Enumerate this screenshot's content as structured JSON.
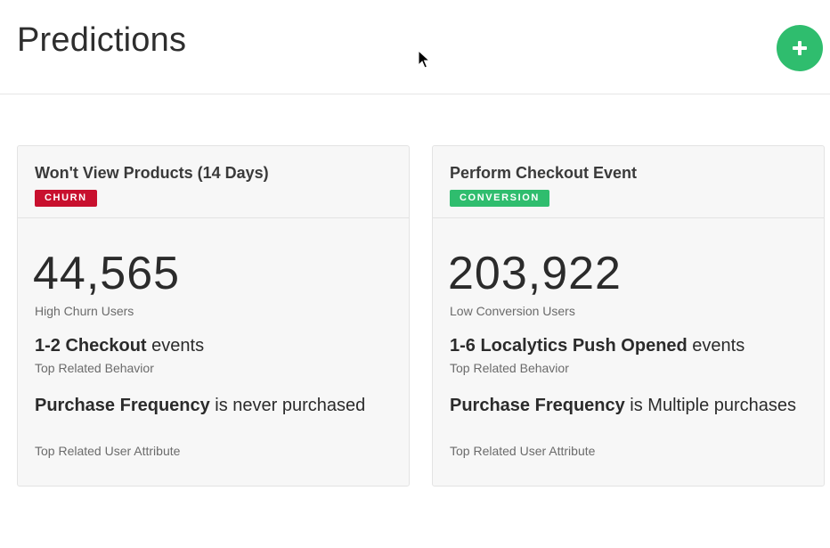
{
  "header": {
    "title": "Predictions",
    "add_button_icon": "plus-icon",
    "accent": "#2fbd6e"
  },
  "cards": [
    {
      "title": "Won't View Products (14 Days)",
      "badge": "CHURN",
      "badge_color": "#c8102e",
      "count": "44,565",
      "count_label": "High Churn Users",
      "behavior_strong": "1-2 Checkout",
      "behavior_rest": " events",
      "behavior_label": "Top Related Behavior",
      "attribute_strong": "Purchase Frequency",
      "attribute_rest": " is never purchased",
      "attribute_label": "Top Related User Attribute"
    },
    {
      "title": "Perform Checkout Event",
      "badge": "CONVERSION",
      "badge_color": "#2fbd6e",
      "count": "203,922",
      "count_label": "Low Conversion Users",
      "behavior_strong": "1-6 Localytics Push Opened",
      "behavior_rest": " events",
      "behavior_label": "Top Related Behavior",
      "attribute_strong": "Purchase Frequency",
      "attribute_rest": " is Multiple purchases",
      "attribute_label": "Top Related User Attribute"
    }
  ]
}
